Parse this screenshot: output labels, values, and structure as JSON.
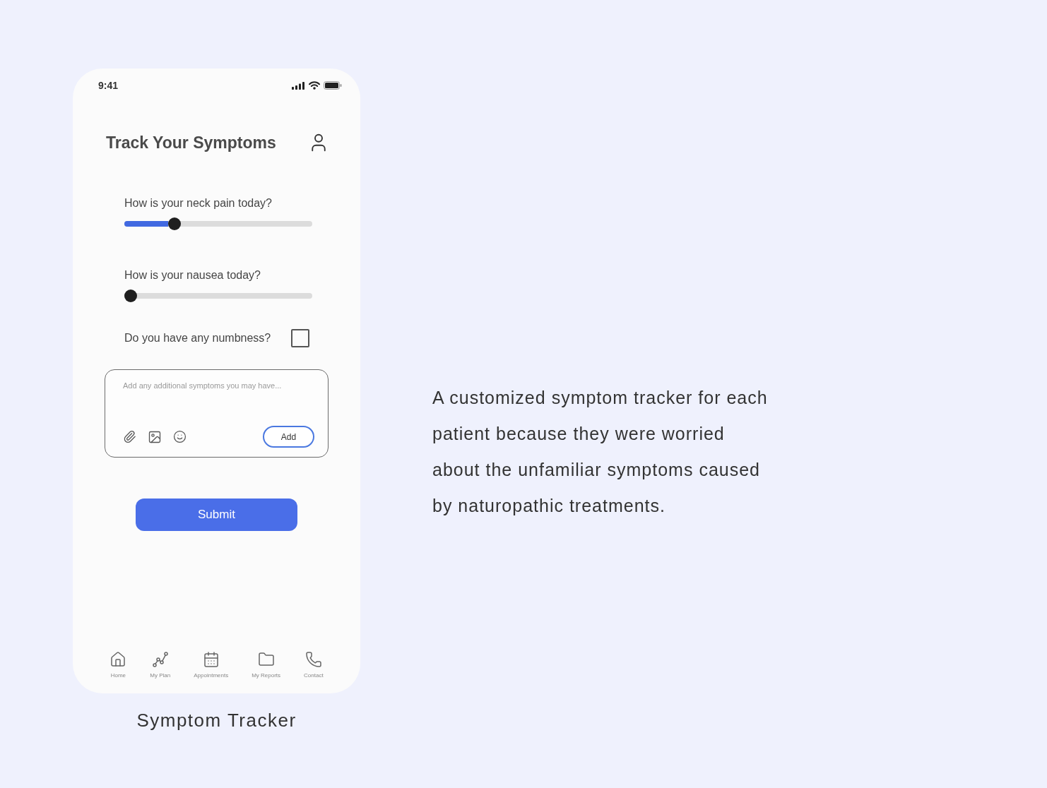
{
  "status_bar": {
    "time": "9:41"
  },
  "header": {
    "title": "Track Your Symptoms"
  },
  "questions": [
    {
      "kind": "slider",
      "label": "How is your neck pain today?",
      "level": 0.25
    },
    {
      "kind": "slider",
      "label": "How is your nausea today?",
      "level": 0
    },
    {
      "kind": "checkbox",
      "label": "Do you have any numbness?",
      "checked": false
    }
  ],
  "notes": {
    "placeholder": "Add any additional symptoms you may have...",
    "add_button": "Add"
  },
  "submit_button": "Submit",
  "nav": [
    {
      "label": "Home"
    },
    {
      "label": "My Plan"
    },
    {
      "label": "Appointments"
    },
    {
      "label": "My Reports"
    },
    {
      "label": "Contact"
    }
  ],
  "caption": "Symptom Tracker",
  "description": "A customized symptom tracker for each patient because they were worried about the unfamiliar symptoms caused by naturopathic treatments."
}
